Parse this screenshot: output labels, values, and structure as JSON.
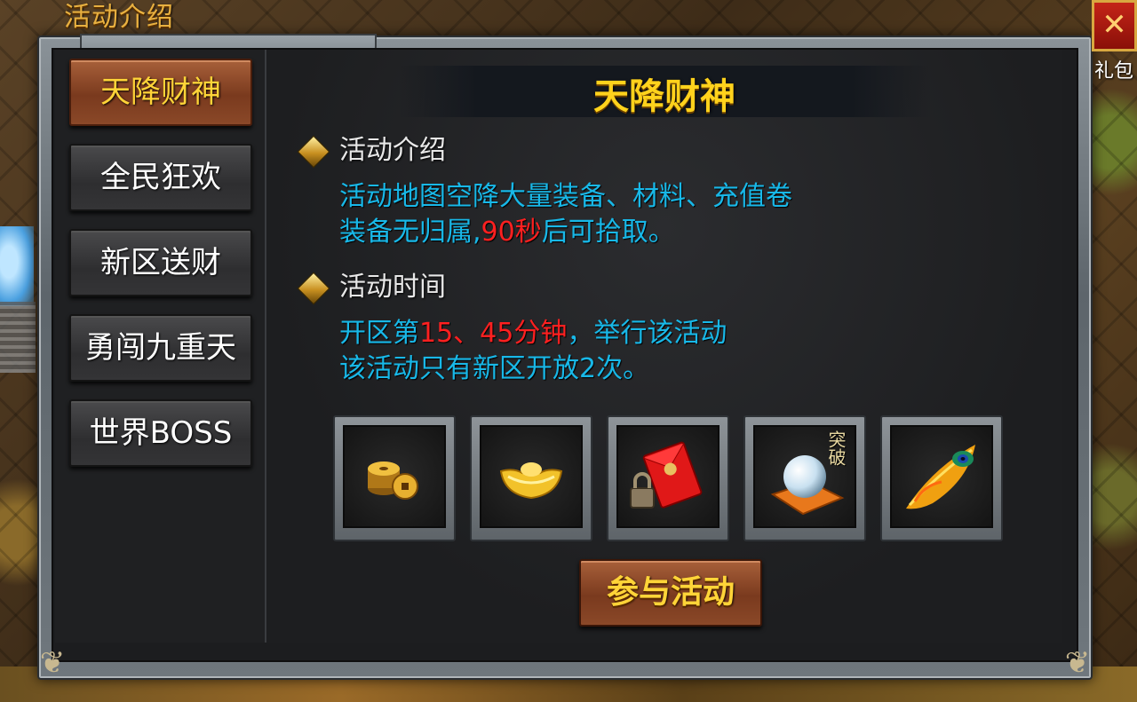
{
  "window": {
    "title": "活动介绍",
    "gift_label": "礼包"
  },
  "sidebar": {
    "items": [
      {
        "label": "天降财神",
        "active": true
      },
      {
        "label": "全民狂欢",
        "active": false
      },
      {
        "label": "新区送财",
        "active": false
      },
      {
        "label": "勇闯九重天",
        "active": false
      },
      {
        "label": "世界BOSS",
        "active": false
      }
    ]
  },
  "panel": {
    "title": "天降财神",
    "sections": [
      {
        "label": "活动介绍",
        "line1": "活动地图空降大量装备、材料、充值卷",
        "line2_prefix": "装备无归属,",
        "line2_highlight": "90秒",
        "line2_suffix": "后可拾取。"
      },
      {
        "label": "活动时间",
        "line1_prefix": "开区第",
        "line1_highlight": "15、45分钟",
        "line1_suffix": "，举行该活动",
        "line2": "该活动只有新区开放2次。"
      }
    ],
    "rewards": [
      {
        "icon": "copper-coins-icon"
      },
      {
        "icon": "gold-ingot-icon"
      },
      {
        "icon": "locked-red-envelope-icon"
      },
      {
        "icon": "crystal-orb-icon",
        "badge": "突破"
      },
      {
        "icon": "phoenix-feather-icon"
      }
    ],
    "join_label": "参与活动"
  },
  "colors": {
    "title_gold": "#ffd21c",
    "desc_cyan": "#18b8e8",
    "highlight_red": "#ff2020",
    "active_tab": "#8a4828"
  }
}
